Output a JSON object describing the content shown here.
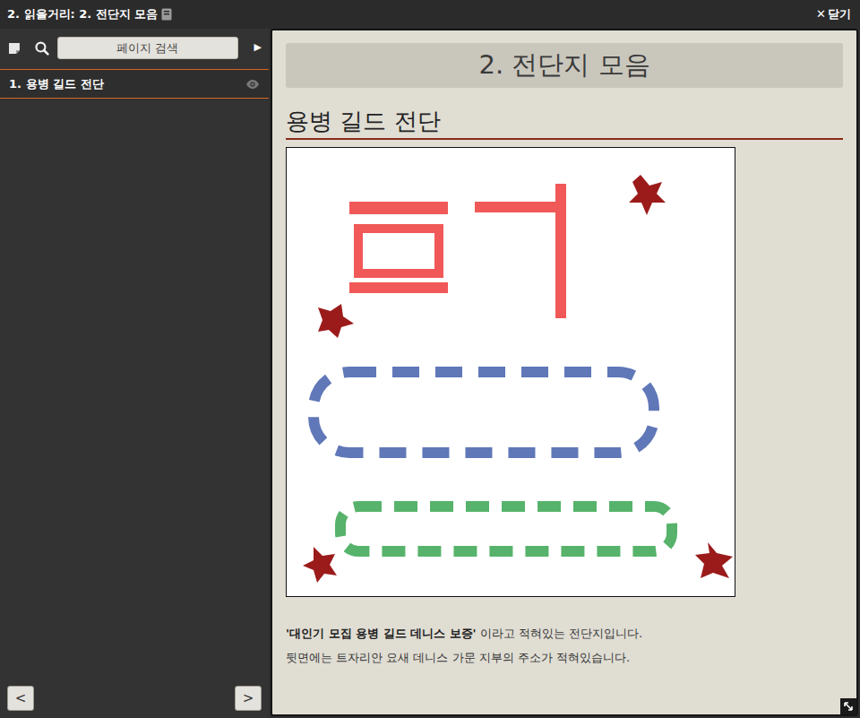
{
  "window": {
    "title": "2. 읽을거리: 2. 전단지 모음",
    "close_icon": "✕",
    "close": "닫기"
  },
  "sidebar": {
    "search": {
      "placeholder": "페이지 검색"
    },
    "expand": "▶",
    "items": [
      {
        "label": "1. 용병 길드 전단",
        "selected": true
      }
    ],
    "prev": "<",
    "next": ">"
  },
  "page": {
    "header": "2. 전단지 모음",
    "title": "용병 길드 전단",
    "caption": [
      [
        {
          "text": "'대인기 모집 용병 길드 데니스 보증'",
          "bold": true
        },
        {
          "text": " 이라고 적혀있는 전단지입니다.",
          "bold": false
        }
      ],
      [
        {
          "text": "뒷면에는 트자리안 요새 데니스 가문 지부의 주소가 적혀있습니다.",
          "bold": false
        }
      ]
    ]
  }
}
